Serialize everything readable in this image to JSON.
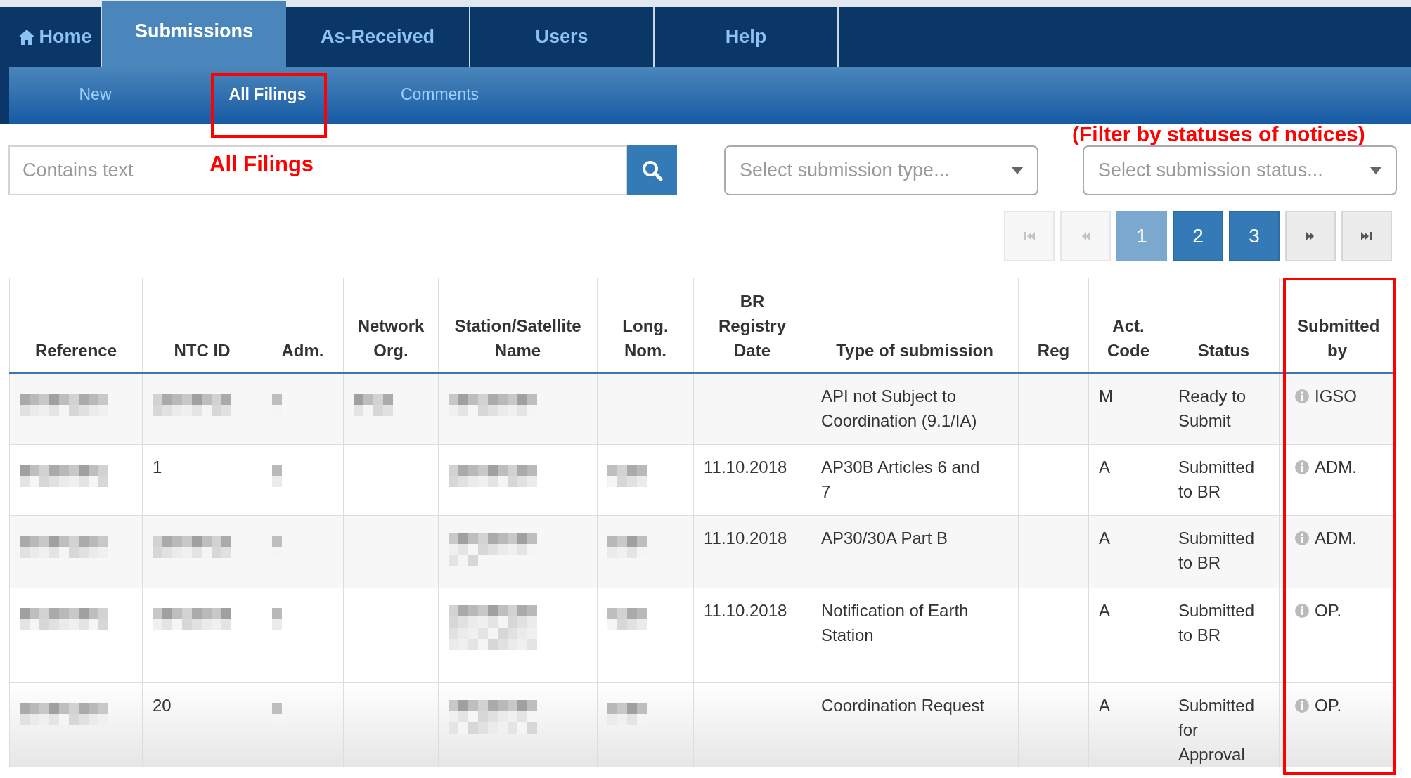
{
  "nav": {
    "tabs": [
      {
        "label": "Home",
        "kind": "home",
        "selected": false
      },
      {
        "label": "Submissions",
        "kind": "plain",
        "selected": true
      },
      {
        "label": "As-Received",
        "kind": "plain",
        "selected": false
      },
      {
        "label": "Users",
        "kind": "plain",
        "selected": false
      },
      {
        "label": "Help",
        "kind": "plain",
        "selected": false
      }
    ],
    "subtabs": [
      {
        "label": "New",
        "selected": false,
        "highlighted": false
      },
      {
        "label": "All Filings",
        "selected": true,
        "highlighted": true,
        "annotation": "All Filings"
      },
      {
        "label": "Comments",
        "selected": false,
        "highlighted": false
      }
    ]
  },
  "filters": {
    "search": {
      "placeholder": "Contains text"
    },
    "type_select": {
      "placeholder": "Select submission type..."
    },
    "status_select": {
      "placeholder": "Select submission status...",
      "annotation": "(Filter by statuses of notices)"
    }
  },
  "pagination": [
    {
      "kind": "first",
      "disabled": true
    },
    {
      "kind": "prev",
      "disabled": true
    },
    {
      "kind": "page",
      "label": "1",
      "selected": true
    },
    {
      "kind": "page",
      "label": "2",
      "selected": false
    },
    {
      "kind": "page",
      "label": "3",
      "selected": false
    },
    {
      "kind": "next",
      "disabled": false
    },
    {
      "kind": "last",
      "disabled": false
    }
  ],
  "table": {
    "columns": [
      {
        "label": "Reference",
        "highlighted": false
      },
      {
        "label": "NTC ID",
        "highlighted": false
      },
      {
        "label": "Adm.",
        "highlighted": false
      },
      {
        "label": "Network Org.",
        "highlighted": false
      },
      {
        "label": "Station/Satellite Name",
        "highlighted": false
      },
      {
        "label": "Long. Nom.",
        "highlighted": false
      },
      {
        "label": "BR Registry Date",
        "highlighted": false
      },
      {
        "label": "Type of submission",
        "highlighted": false
      },
      {
        "label": "Reg",
        "highlighted": false
      },
      {
        "label": "Act. Code",
        "highlighted": false
      },
      {
        "label": "Status",
        "highlighted": false
      },
      {
        "label": "Submitted by",
        "highlighted": true
      }
    ],
    "rows": [
      {
        "cells": [
          {
            "kind": "redacted"
          },
          {
            "kind": "redacted"
          },
          {
            "kind": "redacted"
          },
          {
            "kind": "redacted"
          },
          {
            "kind": "redacted"
          },
          {
            "kind": "empty"
          },
          {
            "kind": "empty"
          },
          {
            "kind": "text",
            "text": "API not Subject to Coordination (9.1/IA)"
          },
          {
            "kind": "empty"
          },
          {
            "kind": "text",
            "text": "M"
          },
          {
            "kind": "text",
            "text": "Ready to Submit"
          },
          {
            "kind": "info",
            "text": "IGSO"
          }
        ]
      },
      {
        "cells": [
          {
            "kind": "redacted"
          },
          {
            "kind": "text",
            "text": "1"
          },
          {
            "kind": "redacted"
          },
          {
            "kind": "empty"
          },
          {
            "kind": "redacted"
          },
          {
            "kind": "redacted"
          },
          {
            "kind": "text",
            "text": "11.10.2018"
          },
          {
            "kind": "text",
            "text": "AP30B Articles 6 and 7"
          },
          {
            "kind": "empty"
          },
          {
            "kind": "text",
            "text": "A"
          },
          {
            "kind": "text",
            "text": "Submitted to BR"
          },
          {
            "kind": "info",
            "text": "ADM."
          }
        ]
      },
      {
        "cells": [
          {
            "kind": "redacted"
          },
          {
            "kind": "redacted"
          },
          {
            "kind": "redacted"
          },
          {
            "kind": "empty"
          },
          {
            "kind": "redacted"
          },
          {
            "kind": "redacted"
          },
          {
            "kind": "text",
            "text": "11.10.2018"
          },
          {
            "kind": "text",
            "text": "AP30/30A Part B"
          },
          {
            "kind": "empty"
          },
          {
            "kind": "text",
            "text": "A"
          },
          {
            "kind": "text",
            "text": "Submitted to BR"
          },
          {
            "kind": "info",
            "text": "ADM."
          }
        ]
      },
      {
        "cells": [
          {
            "kind": "redacted"
          },
          {
            "kind": "redacted"
          },
          {
            "kind": "redacted"
          },
          {
            "kind": "empty"
          },
          {
            "kind": "redacted"
          },
          {
            "kind": "redacted"
          },
          {
            "kind": "text",
            "text": "11.10.2018"
          },
          {
            "kind": "text",
            "text": "Notification of Earth Station"
          },
          {
            "kind": "empty"
          },
          {
            "kind": "text",
            "text": "A"
          },
          {
            "kind": "text",
            "text": "Submitted to BR"
          },
          {
            "kind": "info",
            "text": "OP."
          }
        ]
      },
      {
        "cells": [
          {
            "kind": "redacted"
          },
          {
            "kind": "text",
            "text": "20"
          },
          {
            "kind": "redacted"
          },
          {
            "kind": "empty"
          },
          {
            "kind": "redacted"
          },
          {
            "kind": "redacted"
          },
          {
            "kind": "empty"
          },
          {
            "kind": "text",
            "text": "Coordination Request"
          },
          {
            "kind": "empty"
          },
          {
            "kind": "text",
            "text": "A"
          },
          {
            "kind": "text",
            "text": "Submitted for Approval"
          },
          {
            "kind": "info",
            "text": "OP."
          }
        ]
      }
    ]
  }
}
